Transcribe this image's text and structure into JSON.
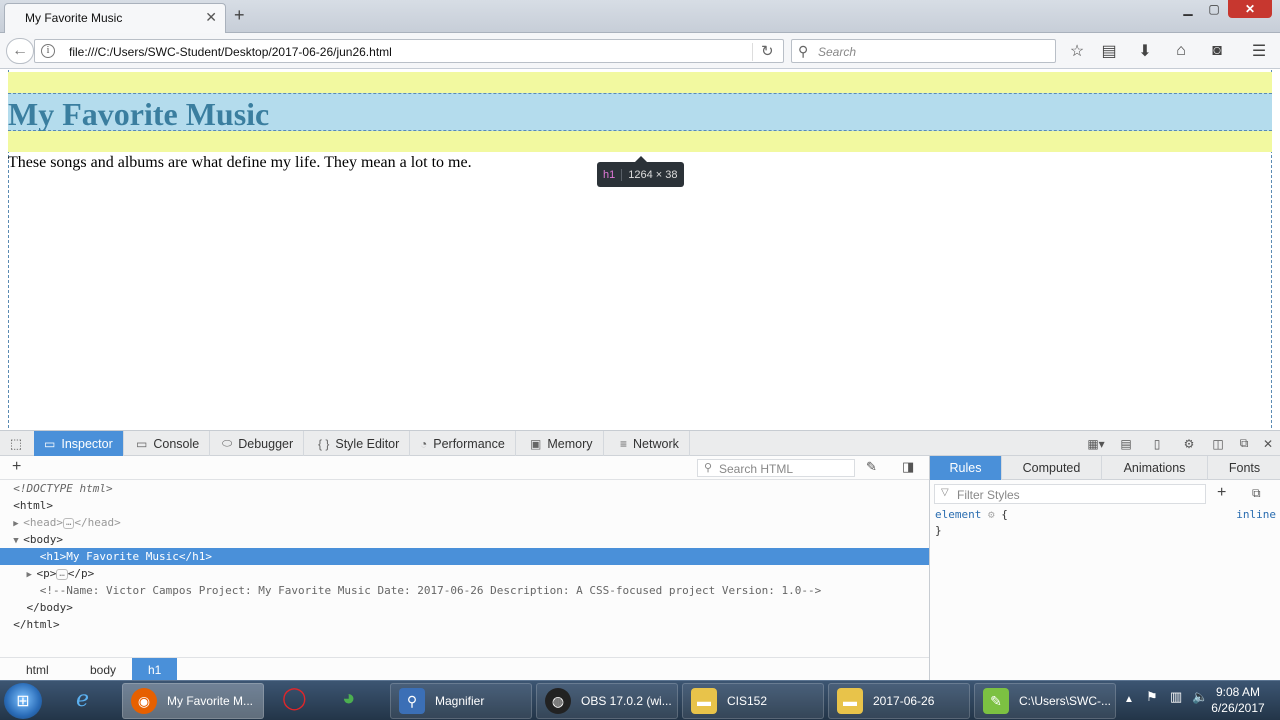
{
  "browser": {
    "tab_title": "My Favorite Music",
    "url": "file:///C:/Users/SWC-Student/Desktop/2017-06-26/jun26.html",
    "search_placeholder": "Search"
  },
  "page": {
    "heading": "My Favorite Music",
    "paragraph": "These songs and albums are what define my life. They mean a lot to me.",
    "highlight_colors": {
      "margin": "#f2f9a0",
      "content": "#b4dced"
    }
  },
  "tooltip": {
    "tag": "h1",
    "dimensions": "1264 × 38"
  },
  "devtools": {
    "tabs": [
      "Inspector",
      "Console",
      "Debugger",
      "Style Editor",
      "Performance",
      "Memory",
      "Network"
    ],
    "active_tab": "Inspector",
    "search_html_placeholder": "Search HTML",
    "markup": {
      "doctype": "<!DOCTYPE html>",
      "html_open": "<html>",
      "head": "<head>",
      "head_close": "</head>",
      "body_open": "<body>",
      "h1": "<h1>My Favorite Music</h1>",
      "p_open": "<p>",
      "p_close": "</p>",
      "comment": "<!--Name: Victor Campos Project: My Favorite Music Date: 2017-06-26 Description: A CSS-focused project Version: 1.0-->",
      "body_close": "</body>",
      "html_close": "</html>"
    },
    "breadcrumbs": [
      "html",
      "body",
      "h1"
    ],
    "sidebar": {
      "tabs": [
        "Rules",
        "Computed",
        "Animations",
        "Fonts"
      ],
      "active_tab": "Rules",
      "filter_placeholder": "Filter Styles",
      "rule_selector": "element",
      "rule_open": "{",
      "rule_close": "}",
      "rule_source": "inline"
    }
  },
  "taskbar": {
    "buttons": [
      {
        "label": "My Favorite M...",
        "icon": "firefox-icon",
        "color": "#e66000"
      },
      {
        "label": "Magnifier",
        "icon": "magnifier-icon",
        "color": "#3b6fb6"
      },
      {
        "label": "OBS 17.0.2 (wi...",
        "icon": "obs-icon",
        "color": "#222222"
      },
      {
        "label": "CIS152",
        "icon": "folder-icon",
        "color": "#e8c34a"
      },
      {
        "label": "2017-06-26",
        "icon": "folder-icon",
        "color": "#e8c34a"
      },
      {
        "label": "C:\\Users\\SWC-...",
        "icon": "notepadpp-icon",
        "color": "#7cc142"
      }
    ],
    "time": "9:08 AM",
    "date": "6/26/2017"
  }
}
